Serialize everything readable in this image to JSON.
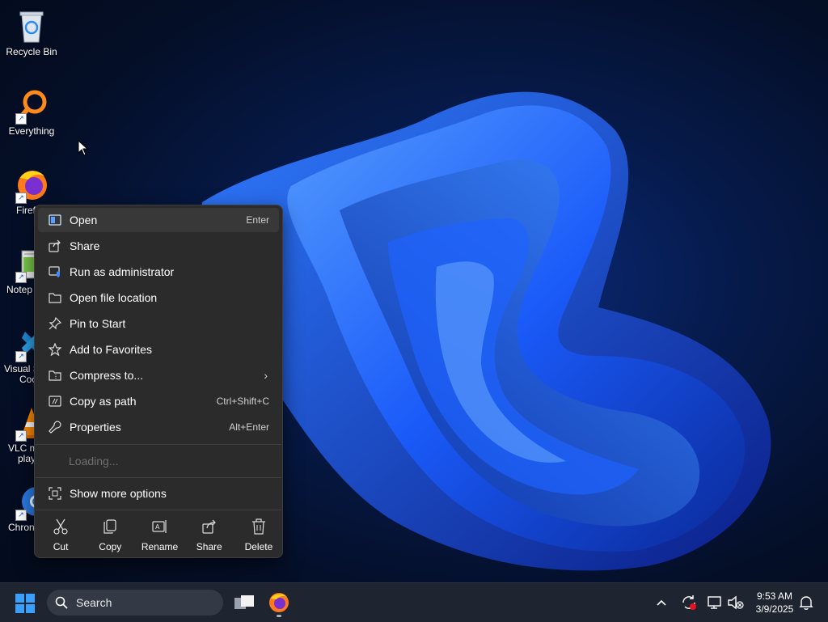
{
  "desktop": {
    "icons": [
      {
        "label": "Recycle Bin"
      },
      {
        "label": "Everything"
      },
      {
        "label": "Firef"
      },
      {
        "label": "Notep"
      },
      {
        "label_line1": "Visual S",
        "label_line2": "Coo"
      },
      {
        "label_line1": "VLC m",
        "label_line2": "play"
      },
      {
        "label": "Chron"
      }
    ]
  },
  "context_menu": {
    "items": [
      {
        "label": "Open",
        "shortcut": "Enter",
        "icon": "open-icon"
      },
      {
        "label": "Share",
        "shortcut": "",
        "icon": "share-icon"
      },
      {
        "label": "Run as administrator",
        "shortcut": "",
        "icon": "shield-icon"
      },
      {
        "label": "Open file location",
        "shortcut": "",
        "icon": "folder-icon"
      },
      {
        "label": "Pin to Start",
        "shortcut": "",
        "icon": "pin-icon"
      },
      {
        "label": "Add to Favorites",
        "shortcut": "",
        "icon": "star-icon"
      },
      {
        "label": "Compress to...",
        "shortcut": "",
        "icon": "zip-icon",
        "submenu": true
      },
      {
        "label": "Copy as path",
        "shortcut": "Ctrl+Shift+C",
        "icon": "path-icon"
      },
      {
        "label": "Properties",
        "shortcut": "Alt+Enter",
        "icon": "wrench-icon"
      }
    ],
    "loading": "Loading...",
    "more_options": "Show more options",
    "quick_actions": [
      {
        "label": "Cut",
        "icon": "scissors-icon"
      },
      {
        "label": "Copy",
        "icon": "copy-icon"
      },
      {
        "label": "Rename",
        "icon": "rename-icon"
      },
      {
        "label": "Share",
        "icon": "share-icon"
      },
      {
        "label": "Delete",
        "icon": "trash-icon"
      }
    ]
  },
  "taskbar": {
    "search_label": "Search",
    "time": "9:53 AM",
    "date": "3/9/2025"
  },
  "colors": {
    "menu_bg": "#2b2b2b",
    "taskbar_bg": "#1f2530",
    "accent": "#0a5fd8"
  }
}
